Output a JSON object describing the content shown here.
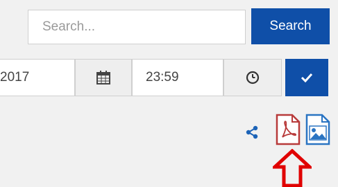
{
  "search": {
    "placeholder": "Search...",
    "button_label": "Search"
  },
  "date_time": {
    "date_value": "2017",
    "time_value": "23:59"
  },
  "icons": {
    "calendar": "calendar-icon",
    "clock": "clock-icon",
    "confirm": "checkmark-icon",
    "share": "share-icon",
    "pdf": "pdf-icon",
    "image": "image-icon",
    "arrow": "up-arrow-icon"
  },
  "colors": {
    "primary": "#0f4fa8",
    "pdf_red": "#b83a3a",
    "arrow_red": "#e00000",
    "image_blue": "#2a74c2"
  }
}
